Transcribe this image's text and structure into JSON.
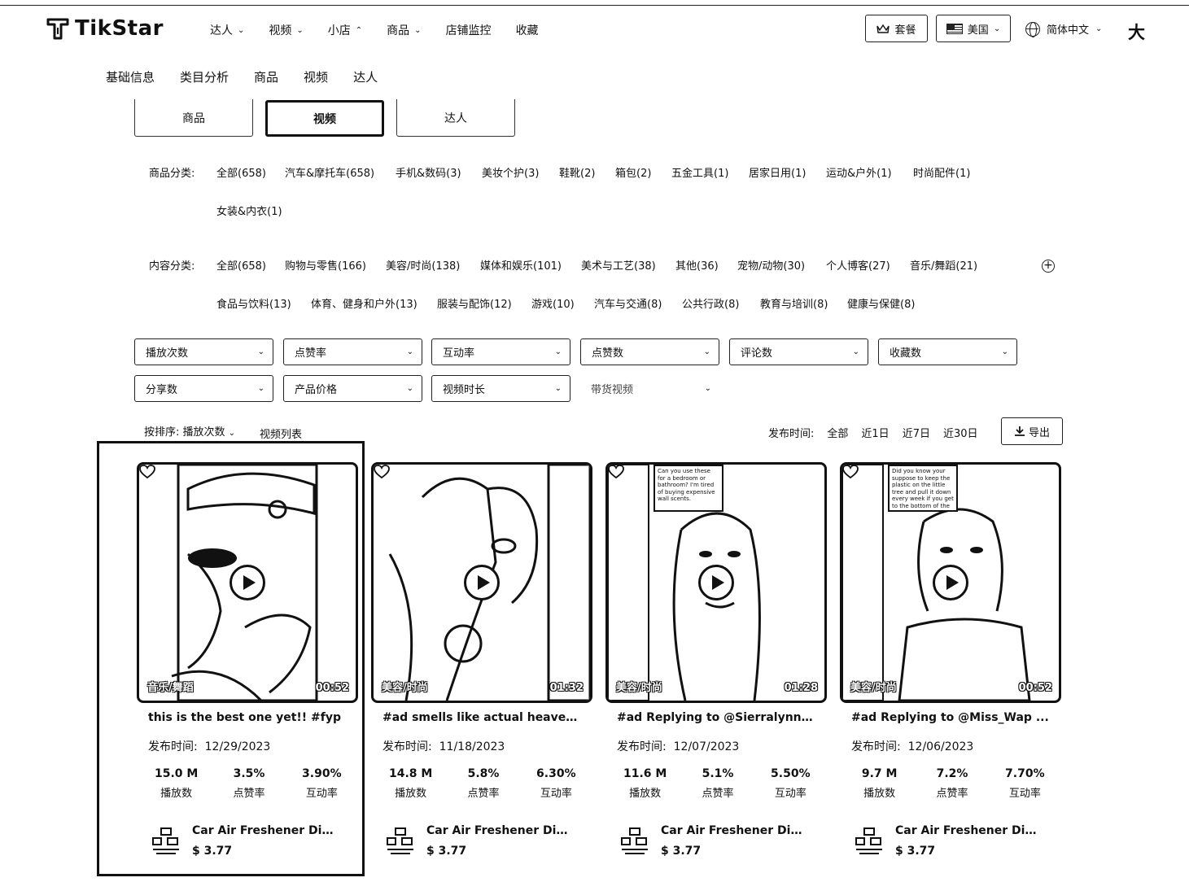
{
  "header": {
    "logo_text": "TikStar",
    "nav": [
      {
        "label": "达人",
        "has_menu": true
      },
      {
        "label": "视频",
        "has_menu": true
      },
      {
        "label": "小店",
        "has_menu": true,
        "open": true
      },
      {
        "label": "商品",
        "has_menu": true
      },
      {
        "label": "店铺监控",
        "has_menu": false
      },
      {
        "label": "收藏",
        "has_menu": false
      }
    ],
    "package_label": "套餐",
    "country_label": "美国",
    "language_label": "简体中文",
    "font_size_label": "大"
  },
  "subtabs": [
    "基础信息",
    "类目分析",
    "商品",
    "视频",
    "达人"
  ],
  "type_tabs": {
    "products": "商品",
    "videos": "视频",
    "creators": "达人",
    "active": "视频"
  },
  "product_category": {
    "label": "商品分类:",
    "items": [
      "全部(658)",
      "汽车&摩托车(658)",
      "手机&数码(3)",
      "美妆个护(3)",
      "鞋靴(2)",
      "箱包(2)",
      "五金工具(1)",
      "居家日用(1)",
      "运动&户外(1)",
      "时尚配件(1)",
      "女装&内衣(1)"
    ]
  },
  "content_category": {
    "label": "内容分类:",
    "items": [
      "全部(658)",
      "购物与零售(166)",
      "美容/时尚(138)",
      "媒体和娱乐(101)",
      "美术与工艺(38)",
      "其他(36)",
      "宠物/动物(30)",
      "个人博客(27)",
      "音乐/舞蹈(21)",
      "食品与饮料(13)",
      "体育、健身和户外(13)",
      "服装与配饰(12)",
      "游戏(10)",
      "汽车与交通(8)",
      "公共行政(8)",
      "教育与培训(8)",
      "健康与保健(8)"
    ]
  },
  "selects": [
    "播放次数",
    "点赞率",
    "互动率",
    "点赞数",
    "评论数",
    "收藏数",
    "分享数",
    "产品价格",
    "视频时长",
    "带货视频"
  ],
  "sort": {
    "label": "按排序: 播放次数",
    "list_view": "视频列表"
  },
  "publish_time": {
    "label": "发布时间:",
    "options": [
      "全部",
      "近1日",
      "近7日",
      "近30日"
    ]
  },
  "export_label": "导出",
  "cards": [
    {
      "tag": "音乐/舞蹈",
      "duration": "00:52",
      "title": "this is the best one yet!! #fyp",
      "date_label": "发布时间:",
      "date": "12/29/2023",
      "views": "15.0 M",
      "like_rate": "3.5%",
      "engagement": "3.90%",
      "views_label": "播放数",
      "like_label": "点赞率",
      "eng_label": "互动率",
      "product": "Car Air Freshener Diff...",
      "price": "$ 3.77"
    },
    {
      "tag": "美容/时尚",
      "duration": "01:32",
      "title": "#ad smells like actual heaven...",
      "date_label": "发布时间:",
      "date": "11/18/2023",
      "views": "14.8 M",
      "like_rate": "5.8%",
      "engagement": "6.30%",
      "views_label": "播放数",
      "like_label": "点赞率",
      "eng_label": "互动率",
      "product": "Car Air Freshener Diff...",
      "price": "$ 3.77"
    },
    {
      "tag": "美容/时尚",
      "duration": "01:28",
      "title": "#ad Replying to @Sierralynn i...",
      "date_label": "发布时间:",
      "date": "12/07/2023",
      "views": "11.6 M",
      "like_rate": "5.1%",
      "engagement": "5.50%",
      "views_label": "播放数",
      "like_label": "点赞率",
      "eng_label": "互动率",
      "product": "Car Air Freshener Diff...",
      "price": "$ 3.77",
      "overlay_text": "Can you use these for a bedroom or bathroom? I'm tired of buying expensive wall scents."
    },
    {
      "tag": "美容/时尚",
      "duration": "00:52",
      "title": "#ad Replying to @Miss_Wap ...",
      "date_label": "发布时间:",
      "date": "12/06/2023",
      "views": "9.7 M",
      "like_rate": "7.2%",
      "engagement": "7.70%",
      "views_label": "播放数",
      "like_label": "点赞率",
      "eng_label": "互动率",
      "product": "Car Air Freshener Diff...",
      "price": "$ 3.77",
      "overlay_text": "Did you know your suppose to keep the plastic on the little tree and pull it down every week if you get to the bottom of the"
    }
  ]
}
